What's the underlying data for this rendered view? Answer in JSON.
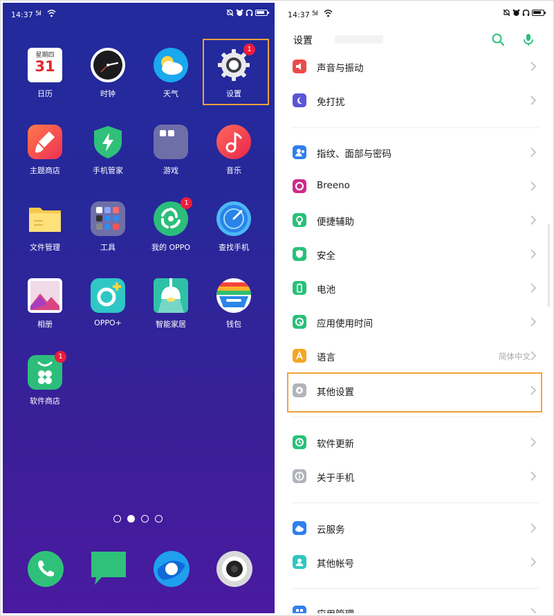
{
  "home": {
    "status": {
      "time": "14:37",
      "signal": "5ıl"
    },
    "apps": [
      {
        "label": "日历",
        "cal_weekday": "星期四",
        "cal_day": "31"
      },
      {
        "label": "时钟"
      },
      {
        "label": "天气"
      },
      {
        "label": "设置",
        "badge": "1"
      },
      {
        "label": "主题商店"
      },
      {
        "label": "手机管家"
      },
      {
        "label": "游戏"
      },
      {
        "label": "音乐"
      },
      {
        "label": "文件管理"
      },
      {
        "label": "工具"
      },
      {
        "label": "我的 OPPO",
        "badge": "1"
      },
      {
        "label": "查找手机"
      },
      {
        "label": "相册"
      },
      {
        "label": "OPPO+"
      },
      {
        "label": "智能家居"
      },
      {
        "label": "钱包"
      },
      {
        "label": "软件商店",
        "badge": "1"
      }
    ],
    "page_count": 4,
    "current_page": 2,
    "highlight_color": "#f0a23b"
  },
  "settings": {
    "status": {
      "time": "14:37",
      "signal": "5ıl"
    },
    "header": {
      "title": "设置"
    },
    "rows": [
      {
        "label": "声音与振动",
        "icon": "speaker-icon",
        "color": "#ef4a4a"
      },
      {
        "label": "免打扰",
        "icon": "moon-icon",
        "color": "#5b54d6"
      },
      {
        "label": "指纹、面部与密码",
        "icon": "face-id-icon",
        "color": "#2f7fee"
      },
      {
        "label": "Breeno",
        "icon": "breeno-icon",
        "color": "#d02a8a"
      },
      {
        "label": "便捷辅助",
        "icon": "assist-icon",
        "color": "#28c178"
      },
      {
        "label": "安全",
        "icon": "shield-icon",
        "color": "#28c178"
      },
      {
        "label": "电池",
        "icon": "battery-icon",
        "color": "#28c178"
      },
      {
        "label": "应用使用时间",
        "icon": "hourglass-icon",
        "color": "#28c178"
      },
      {
        "label": "语言",
        "value": "简体中文",
        "icon": "language-icon",
        "color": "#f5a623"
      },
      {
        "label": "其他设置",
        "icon": "gear-icon",
        "color": "#b0b4bb"
      },
      {
        "label": "软件更新",
        "icon": "update-icon",
        "color": "#28c178"
      },
      {
        "label": "关于手机",
        "icon": "info-icon",
        "color": "#b0b4bb"
      },
      {
        "label": "云服务",
        "icon": "cloud-icon",
        "color": "#2f7fee"
      },
      {
        "label": "其他帐号",
        "icon": "account-icon",
        "color": "#2ec7c0"
      },
      {
        "label": "应用管理",
        "icon": "app-manage-icon",
        "color": "#2f7fee"
      }
    ],
    "accent_color": "#2bc07c"
  }
}
